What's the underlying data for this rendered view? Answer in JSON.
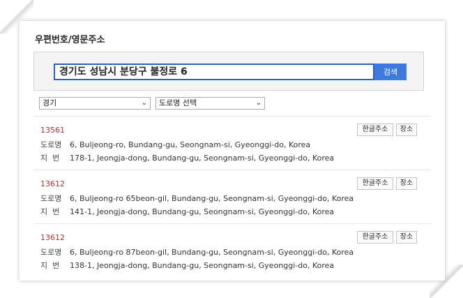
{
  "title": "우편번호/영문주소",
  "search": {
    "value": "경기도 성남시 분당구 불정로 6",
    "button_label": "검색"
  },
  "filters": {
    "region": "경기",
    "road": "도로명 선택"
  },
  "labels": {
    "road": "도로명",
    "lot": "지  번",
    "korean_button": "한글주소",
    "place_button": "장소"
  },
  "results": [
    {
      "zip": "13561",
      "road": "6, Buljeong-ro, Bundang-gu, Seongnam-si, Gyeonggi-do, Korea",
      "lot": "178-1, Jeongja-dong, Bundang-gu, Seongnam-si, Gyeonggi-do, Korea"
    },
    {
      "zip": "13612",
      "road": "6, Buljeong-ro 65beon-gil, Bundang-gu, Seongnam-si, Gyeonggi-do, Korea",
      "lot": "141-1, Jeongja-dong, Bundang-gu, Seongnam-si, Gyeonggi-do, Korea"
    },
    {
      "zip": "13612",
      "road": "6, Buljeong-ro 87beon-gil, Bundang-gu, Seongnam-si, Gyeonggi-do, Korea",
      "lot": "138-1, Jeongja-dong, Bundang-gu, Seongnam-si, Gyeonggi-do, Korea"
    }
  ],
  "colors": {
    "accent": "#3d7ae0",
    "zip": "#b03030"
  }
}
